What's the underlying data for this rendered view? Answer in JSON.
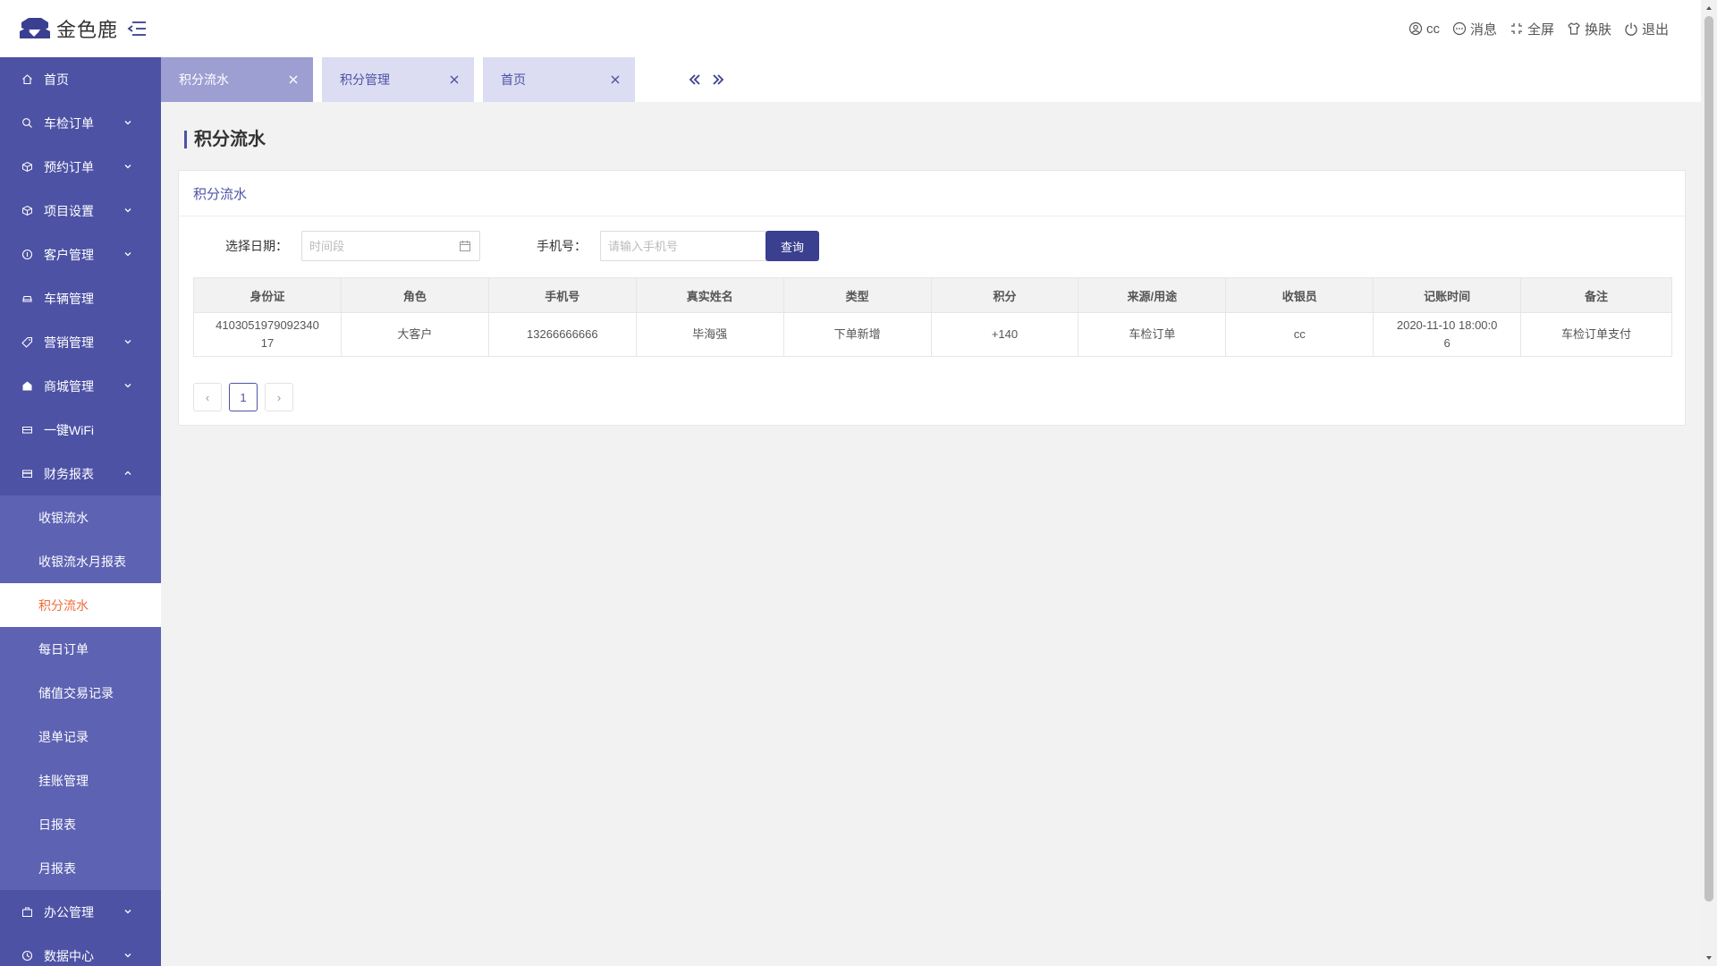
{
  "app": {
    "name": "金色鹿"
  },
  "header": {
    "items": [
      {
        "label": "cc",
        "icon": "user-icon"
      },
      {
        "label": "消息",
        "icon": "message-icon"
      },
      {
        "label": "全屏",
        "icon": "fullscreen-icon"
      },
      {
        "label": "换肤",
        "icon": "skin-icon"
      },
      {
        "label": "退出",
        "icon": "logout-icon"
      }
    ]
  },
  "sidebar": {
    "items": [
      {
        "label": "首页",
        "icon": "home-icon",
        "expandable": false
      },
      {
        "label": "车检订单",
        "icon": "search-icon",
        "expandable": true
      },
      {
        "label": "预约订单",
        "icon": "box-icon",
        "expandable": true
      },
      {
        "label": "项目设置",
        "icon": "box-icon",
        "expandable": true
      },
      {
        "label": "客户管理",
        "icon": "customer-icon",
        "expandable": true
      },
      {
        "label": "车辆管理",
        "icon": "car-icon",
        "expandable": false
      },
      {
        "label": "营销管理",
        "icon": "tag-icon",
        "expandable": true
      },
      {
        "label": "商城管理",
        "icon": "shop-icon",
        "expandable": true
      },
      {
        "label": "一键WiFi",
        "icon": "wifi-icon",
        "expandable": false
      },
      {
        "label": "财务报表",
        "icon": "finance-icon",
        "expandable": true,
        "open": true
      },
      {
        "label": "办公管理",
        "icon": "office-icon",
        "expandable": true
      },
      {
        "label": "数据中心",
        "icon": "data-icon",
        "expandable": true
      }
    ],
    "finance_sub": [
      {
        "label": "收银流水",
        "active": false
      },
      {
        "label": "收银流水月报表",
        "active": false
      },
      {
        "label": "积分流水",
        "active": true
      },
      {
        "label": "每日订单",
        "active": false
      },
      {
        "label": "储值交易记录",
        "active": false
      },
      {
        "label": "退单记录",
        "active": false
      },
      {
        "label": "挂账管理",
        "active": false
      },
      {
        "label": "日报表",
        "active": false
      },
      {
        "label": "月报表",
        "active": false
      }
    ]
  },
  "tabs": [
    {
      "label": "积分流水",
      "active": true
    },
    {
      "label": "积分管理",
      "active": false
    },
    {
      "label": "首页",
      "active": false
    }
  ],
  "page": {
    "title": "积分流水",
    "panel_title": "积分流水",
    "filters": {
      "date_label": "选择日期：",
      "date_placeholder": "时间段",
      "phone_label": "手机号：",
      "phone_placeholder": "请输入手机号",
      "query_button": "查询"
    },
    "table": {
      "columns": [
        "身份证",
        "角色",
        "手机号",
        "真实姓名",
        "类型",
        "积分",
        "来源/用途",
        "收银员",
        "记账时间",
        "备注"
      ],
      "rows": [
        [
          "410305197909234017",
          "大客户",
          "13266666666",
          "毕海强",
          "下单新增",
          "+140",
          "车检订单",
          "cc",
          "2020-11-10 18:00:06",
          "车检订单支付"
        ]
      ],
      "display_rows": [
        [
          "4103051979092340\n17",
          "大客户",
          "13266666666",
          "毕海强",
          "下单新增",
          "+140",
          "车检订单",
          "cc",
          "2020-11-10 18:00:0\n6",
          "车检订单支付"
        ]
      ]
    },
    "pagination": {
      "prev": "‹",
      "current": "1",
      "next": "›"
    }
  },
  "colors": {
    "sidebar_bg": "#4d52a5",
    "submenu_bg": "#5d62b3",
    "active_sub_text": "#f06b3c",
    "tab_active_bg": "#9d9fd2",
    "tab_inactive_bg": "#dcdcf2",
    "query_button_bg": "#3b3f8f"
  }
}
